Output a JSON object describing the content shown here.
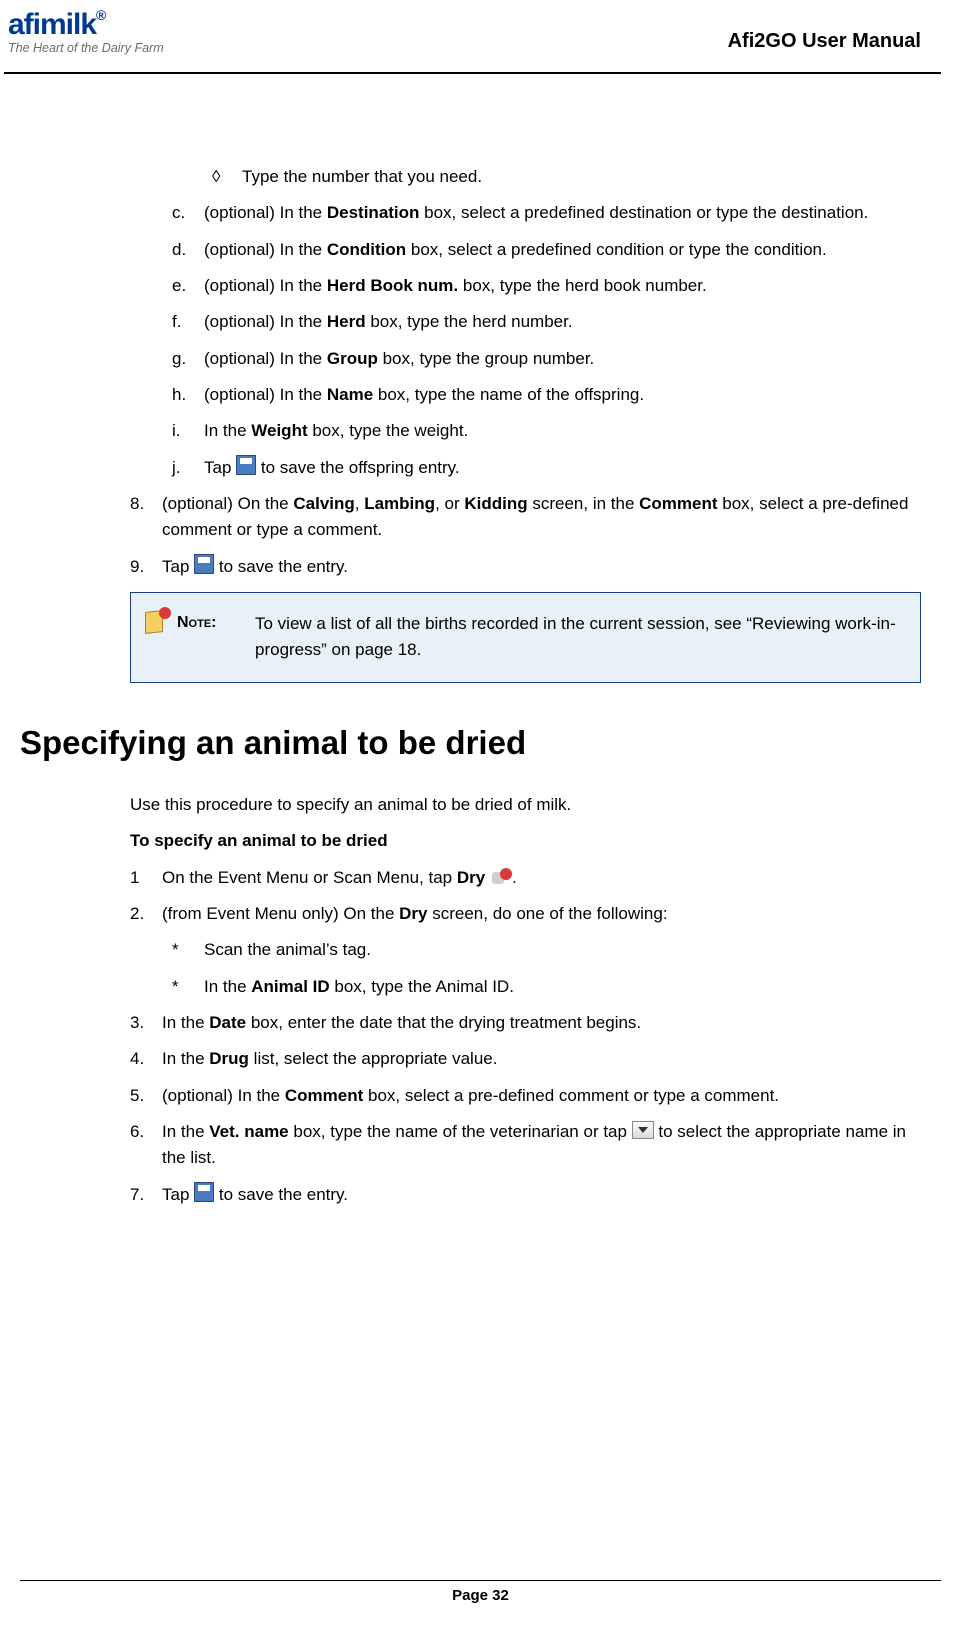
{
  "header": {
    "logo_text": "afimilk",
    "logo_reg": "®",
    "logo_tagline": "The Heart of the Dairy Farm",
    "doc_title": "Afi2GO User Manual"
  },
  "section1": {
    "diamond_item": "Type the number that you need.",
    "letter_items": [
      {
        "m": "c.",
        "pre": "(optional) In the ",
        "b": "Destination",
        "post": " box, select a predefined destination or type the destination."
      },
      {
        "m": "d.",
        "pre": "(optional) In the ",
        "b": "Condition",
        "post": " box, select a predefined condition or type the condition."
      },
      {
        "m": "e.",
        "pre": "(optional) In the ",
        "b": "Herd Book num.",
        "post": " box, type the herd book number."
      },
      {
        "m": "f.",
        "pre": "(optional) In the ",
        "b": "Herd",
        "post": " box, type the herd number."
      },
      {
        "m": "g.",
        "pre": "(optional) In the ",
        "b": "Group",
        "post": " box, type the group number."
      },
      {
        "m": "h.",
        "pre": "(optional) In the ",
        "b": "Name",
        "post": " box, type the name of the offspring."
      },
      {
        "m": "i.",
        "pre": "In the ",
        "b": "Weight",
        "post": " box, type the weight."
      }
    ],
    "letter_j": {
      "m": "j.",
      "pre": "Tap ",
      "post": " to save the offspring entry."
    },
    "num8": {
      "m": "8.",
      "pre": "(optional) On the ",
      "b1": "Calving",
      "mid1": ", ",
      "b2": "Lambing",
      "mid2": ", or ",
      "b3": "Kidding",
      "mid3": " screen, in the ",
      "b4": "Comment",
      "post": " box, select a pre-defined comment or type a comment."
    },
    "num9": {
      "m": "9.",
      "pre": "Tap ",
      "post": " to save the entry."
    },
    "note": {
      "label": "Note:",
      "text": "To view a list of all the births recorded in the current session, see “Reviewing work-in-progress” on page 18."
    }
  },
  "section2": {
    "title": "Specifying an animal to be dried",
    "intro": "Use this procedure to specify an animal to be dried of milk.",
    "subhead": "To specify an animal to be dried",
    "s1": {
      "m": "1",
      "pre": "On the Event Menu or Scan Menu, tap ",
      "b": "Dry",
      "post": "."
    },
    "s2": {
      "m": "2.",
      "pre": "(from Event Menu only) On the ",
      "b": "Dry",
      "post": " screen, do one of the following:"
    },
    "star1": "Scan the animal’s tag.",
    "star2": {
      "pre": "In the ",
      "b": "Animal ID",
      "post": " box, type the Animal ID."
    },
    "s3": {
      "m": "3.",
      "pre": "In the ",
      "b": "Date",
      "post": " box, enter the date that the drying treatment begins."
    },
    "s4": {
      "m": "4.",
      "pre": "In the ",
      "b": "Drug",
      "post": " list, select the appropriate value."
    },
    "s5": {
      "m": "5.",
      "pre": "(optional) In the ",
      "b": "Comment",
      "post": " box, select a pre-defined comment or type a comment."
    },
    "s6": {
      "m": "6.",
      "pre": "In the ",
      "b": "Vet. name",
      "post1": " box, type the name of the veterinarian or tap ",
      "post2": " to select the appropriate name in the list."
    },
    "s7": {
      "m": "7.",
      "pre": "Tap ",
      "post": " to save the entry."
    }
  },
  "footer": {
    "page": "Page 32"
  }
}
